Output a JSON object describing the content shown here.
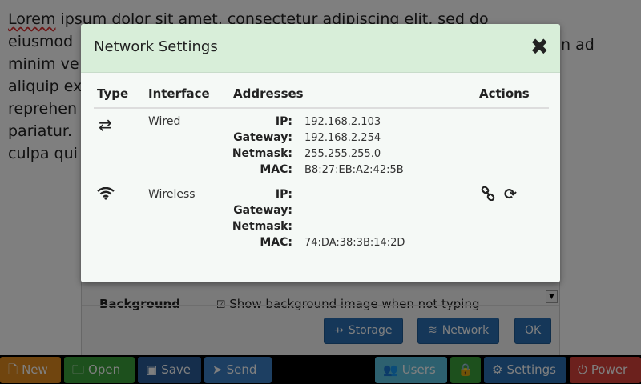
{
  "editor": {
    "lines": [
      "Lorem ipsum dolor sit amet, consectetur adipiscing elit, sed do",
      "eiusmod",
      "minim ve",
      "aliquip ex",
      "reprehen",
      "pariatur.",
      "culpa qui"
    ],
    "line2_tail": "n ad"
  },
  "settings_dialog": {
    "background_label": "Background",
    "background_checkbox": "Show background image when not typing",
    "buttons": {
      "storage": "Storage",
      "network": "Network",
      "ok": "OK"
    }
  },
  "taskbar": {
    "new": "New",
    "open": "Open",
    "save": "Save",
    "send": "Send",
    "users": "Users",
    "settings": "Settings",
    "power": "Power"
  },
  "modal": {
    "title": "Network Settings",
    "close": "✖",
    "columns": {
      "type": "Type",
      "interface": "Interface",
      "addresses": "Addresses",
      "actions": "Actions"
    },
    "address_labels": {
      "ip": "IP:",
      "gateway": "Gateway:",
      "netmask": "Netmask:",
      "mac": "MAC:"
    },
    "rows": [
      {
        "type_icon": "exchange-icon",
        "interface": "Wired",
        "ip": "192.168.2.103",
        "gateway": "192.168.2.254",
        "netmask": "255.255.255.0",
        "mac": "B8:27:EB:A2:42:5B"
      },
      {
        "type_icon": "wifi-icon",
        "interface": "Wireless",
        "ip": "",
        "gateway": "",
        "netmask": "",
        "mac": "74:DA:38:3B:14:2D",
        "actions": [
          "link-icon",
          "refresh-icon"
        ]
      }
    ]
  },
  "colors": {
    "new": "#e08a1e",
    "open": "#3aa03a",
    "save": "#2a5d99",
    "send": "#3b7fc4",
    "users": "#5bc0de",
    "lock": "#3aa03a",
    "settings": "#2b6fb3",
    "power": "#d9433b",
    "modal_header": "#d8eed9"
  }
}
